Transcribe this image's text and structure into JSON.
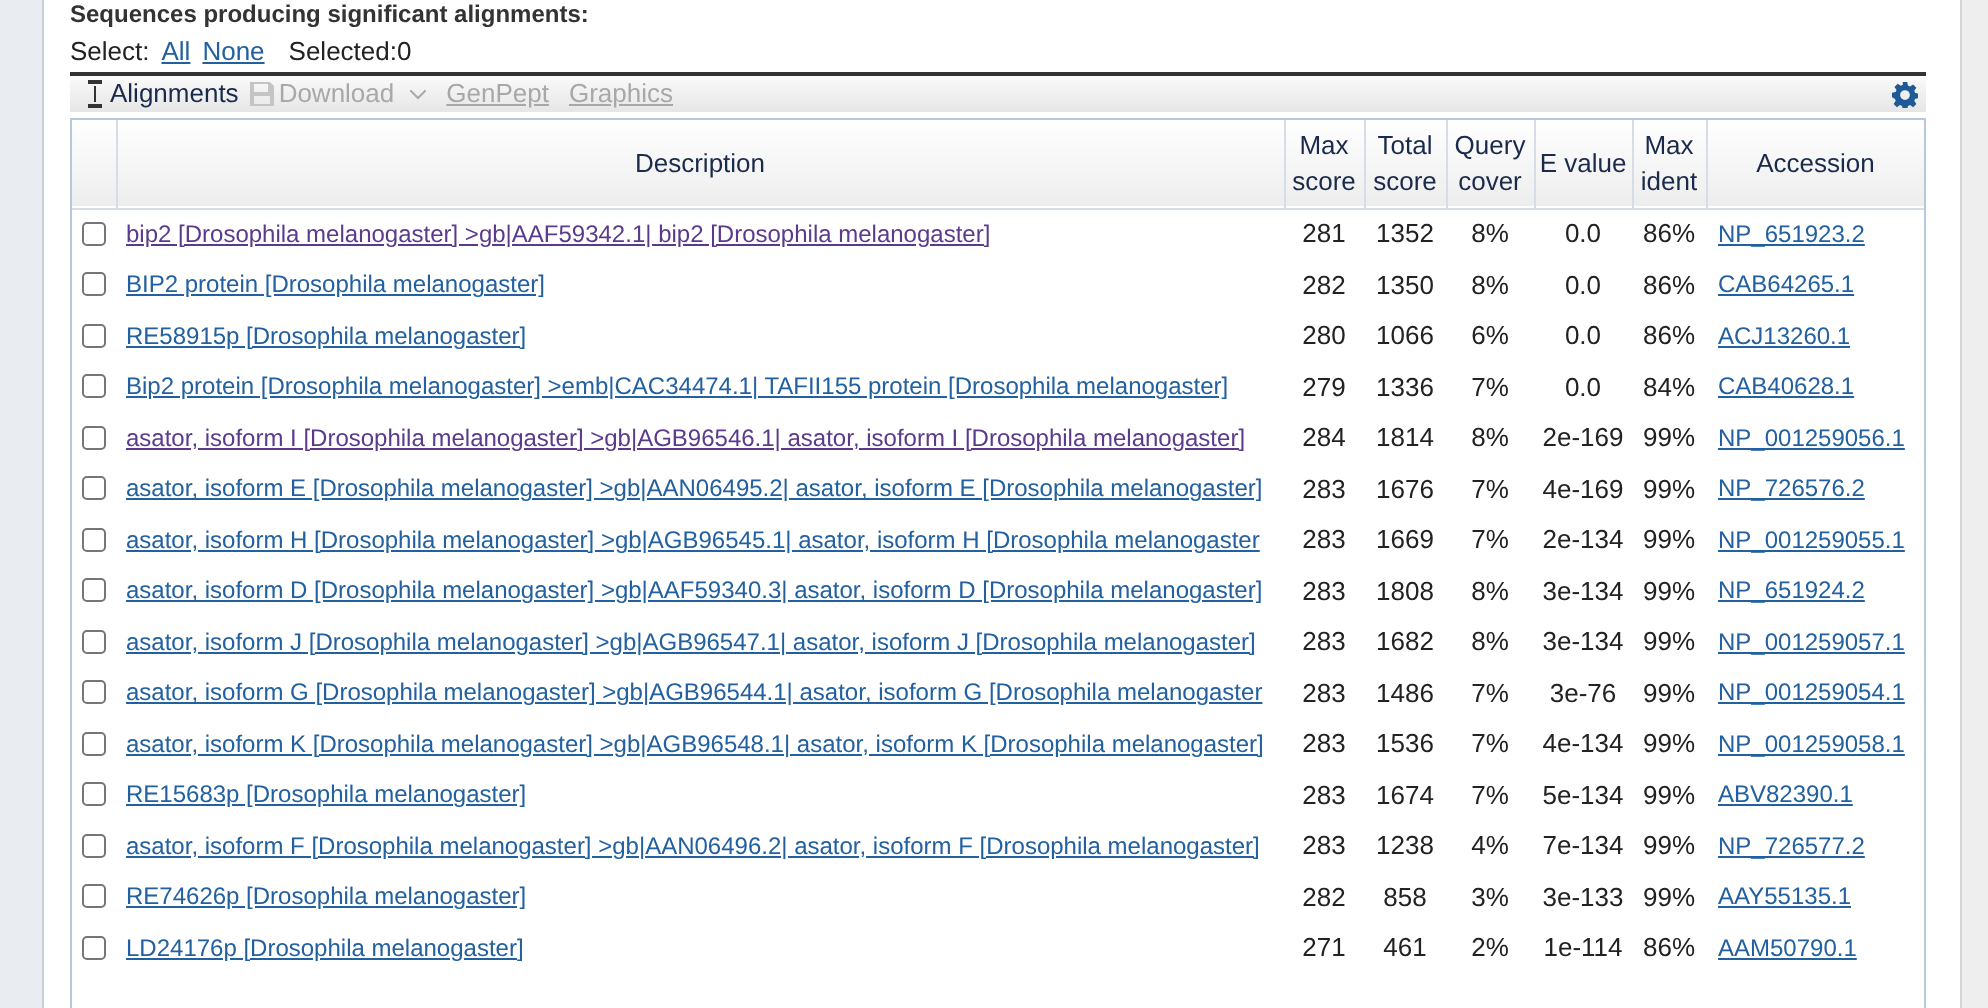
{
  "heading": "Sequences producing significant alignments:",
  "select": {
    "label": "Select:",
    "links": [
      "All",
      "None"
    ],
    "selected_count": "Selected:0"
  },
  "toolbar": {
    "items": [
      {
        "label": "Alignments",
        "kind": "alignments",
        "disabled": false
      },
      {
        "label": "Download",
        "kind": "download",
        "disabled": true
      },
      {
        "label": "GenPept",
        "kind": "link",
        "disabled": true
      },
      {
        "label": "Graphics",
        "kind": "link",
        "disabled": true
      }
    ]
  },
  "table": {
    "columns": [
      {
        "label": "Description"
      },
      {
        "label": "Max score"
      },
      {
        "label": "Total score"
      },
      {
        "label": "Query cover"
      },
      {
        "label": "E value"
      },
      {
        "label": "Max ident"
      },
      {
        "label": "Accession"
      }
    ],
    "rows": [
      {
        "checked": false,
        "visited": true,
        "description": "bip2 [Drosophila melanogaster] >gb|AAF59342.1| bip2 [Drosophila melanogaster]",
        "max_score": "281",
        "total_score": "1352",
        "query_cover": "8%",
        "e_value": "0.0",
        "max_ident": "86%",
        "accession": "NP_651923.2"
      },
      {
        "checked": false,
        "visited": false,
        "description": "BIP2 protein [Drosophila melanogaster]",
        "max_score": "282",
        "total_score": "1350",
        "query_cover": "8%",
        "e_value": "0.0",
        "max_ident": "86%",
        "accession": "CAB64265.1"
      },
      {
        "checked": false,
        "visited": false,
        "description": "RE58915p [Drosophila melanogaster]",
        "max_score": "280",
        "total_score": "1066",
        "query_cover": "6%",
        "e_value": "0.0",
        "max_ident": "86%",
        "accession": "ACJ13260.1"
      },
      {
        "checked": false,
        "visited": false,
        "description": "Bip2 protein [Drosophila melanogaster] >emb|CAC34474.1| TAFII155 protein [Drosophila melanogaster]",
        "max_score": "279",
        "total_score": "1336",
        "query_cover": "7%",
        "e_value": "0.0",
        "max_ident": "84%",
        "accession": "CAB40628.1"
      },
      {
        "checked": false,
        "visited": true,
        "description": "asator, isoform I [Drosophila melanogaster] >gb|AGB96546.1| asator, isoform I [Drosophila melanogaster]",
        "max_score": "284",
        "total_score": "1814",
        "query_cover": "8%",
        "e_value": "2e-169",
        "max_ident": "99%",
        "accession": "NP_001259056.1"
      },
      {
        "checked": false,
        "visited": false,
        "description": "asator, isoform E [Drosophila melanogaster] >gb|AAN06495.2| asator, isoform E [Drosophila melanogaster]",
        "max_score": "283",
        "total_score": "1676",
        "query_cover": "7%",
        "e_value": "4e-169",
        "max_ident": "99%",
        "accession": "NP_726576.2"
      },
      {
        "checked": false,
        "visited": false,
        "description": "asator, isoform H [Drosophila melanogaster] >gb|AGB96545.1| asator, isoform H [Drosophila melanogaster",
        "max_score": "283",
        "total_score": "1669",
        "query_cover": "7%",
        "e_value": "2e-134",
        "max_ident": "99%",
        "accession": "NP_001259055.1"
      },
      {
        "checked": false,
        "visited": false,
        "description": "asator, isoform D [Drosophila melanogaster] >gb|AAF59340.3| asator, isoform D [Drosophila melanogaster]",
        "max_score": "283",
        "total_score": "1808",
        "query_cover": "8%",
        "e_value": "3e-134",
        "max_ident": "99%",
        "accession": "NP_651924.2"
      },
      {
        "checked": false,
        "visited": false,
        "description": "asator, isoform J [Drosophila melanogaster] >gb|AGB96547.1| asator, isoform J [Drosophila melanogaster]",
        "max_score": "283",
        "total_score": "1682",
        "query_cover": "8%",
        "e_value": "3e-134",
        "max_ident": "99%",
        "accession": "NP_001259057.1"
      },
      {
        "checked": false,
        "visited": false,
        "description": "asator, isoform G [Drosophila melanogaster] >gb|AGB96544.1| asator, isoform G [Drosophila melanogaster",
        "max_score": "283",
        "total_score": "1486",
        "query_cover": "7%",
        "e_value": "3e-76",
        "max_ident": "99%",
        "accession": "NP_001259054.1"
      },
      {
        "checked": false,
        "visited": false,
        "description": "asator, isoform K [Drosophila melanogaster] >gb|AGB96548.1| asator, isoform K [Drosophila melanogaster]",
        "max_score": "283",
        "total_score": "1536",
        "query_cover": "7%",
        "e_value": "4e-134",
        "max_ident": "99%",
        "accession": "NP_001259058.1"
      },
      {
        "checked": false,
        "visited": false,
        "description": "RE15683p [Drosophila melanogaster]",
        "max_score": "283",
        "total_score": "1674",
        "query_cover": "7%",
        "e_value": "5e-134",
        "max_ident": "99%",
        "accession": "ABV82390.1"
      },
      {
        "checked": false,
        "visited": false,
        "description": "asator, isoform F [Drosophila melanogaster] >gb|AAN06496.2| asator, isoform F [Drosophila melanogaster]",
        "max_score": "283",
        "total_score": "1238",
        "query_cover": "4%",
        "e_value": "7e-134",
        "max_ident": "99%",
        "accession": "NP_726577.2"
      },
      {
        "checked": false,
        "visited": false,
        "description": "RE74626p [Drosophila melanogaster]",
        "max_score": "282",
        "total_score": "858",
        "query_cover": "3%",
        "e_value": "3e-133",
        "max_ident": "99%",
        "accession": "AAY55135.1"
      },
      {
        "checked": false,
        "visited": false,
        "description": "LD24176p [Drosophila melanogaster]",
        "max_score": "271",
        "total_score": "461",
        "query_cover": "2%",
        "e_value": "1e-114",
        "max_ident": "86%",
        "accession": "AAM50790.1"
      }
    ]
  }
}
